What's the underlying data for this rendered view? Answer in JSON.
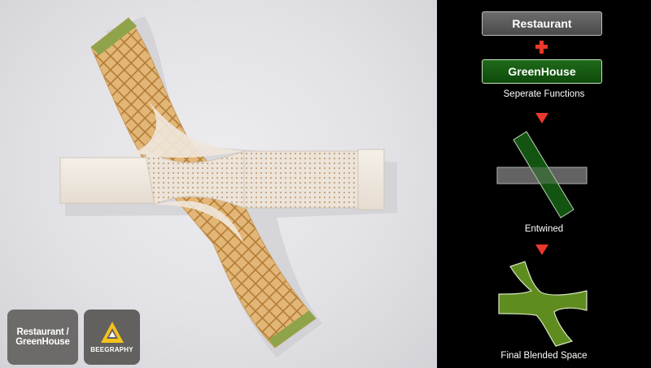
{
  "render": {
    "icons": [
      "blended-building-aerial-render"
    ]
  },
  "badges": {
    "project_line1": "Restaurant /",
    "project_line2": "GreenHouse",
    "brand": "BEEGRAPHY",
    "brand_icon": "beegraphy-logo-icon"
  },
  "diagram": {
    "restaurant_label": "Restaurant",
    "greenhouse_label": "GreenHouse",
    "plus_icon": "plus-icon",
    "caption_separate": "Seperate Functions",
    "caption_entwined": "Entwined",
    "caption_final": "Final Blended Space",
    "arrow_icon": "arrow-down-triangle-icon",
    "colors": {
      "restaurant": "#5a5a5a",
      "greenhouse": "#155c12",
      "accent": "#e8382b",
      "blended": "#5f8c1f"
    }
  }
}
